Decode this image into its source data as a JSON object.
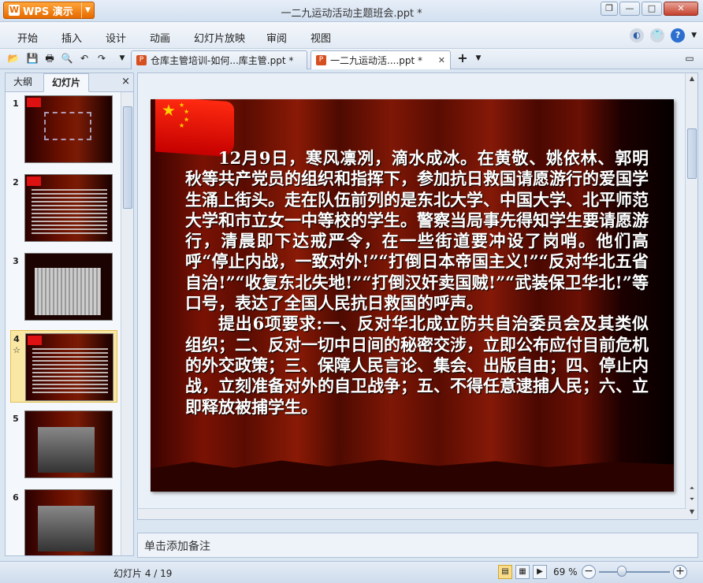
{
  "app": {
    "name": "WPS 演示",
    "doc_title": "一二九运动活动主题班会.ppt *"
  },
  "window_controls": {
    "restore": "❐",
    "minimize": "—",
    "maximize": "□",
    "close": "✕"
  },
  "menu": [
    "开始",
    "插入",
    "设计",
    "动画",
    "幻灯片放映",
    "审阅",
    "视图"
  ],
  "tabs": [
    {
      "label": "仓库主管培训-如何...库主管.ppt *"
    },
    {
      "label": "一二九运动活....ppt *"
    }
  ],
  "side_tabs": [
    "大纲",
    "幻灯片"
  ],
  "side_close": "×",
  "thumbnails": [
    {
      "num": "1"
    },
    {
      "num": "2"
    },
    {
      "num": "3"
    },
    {
      "num": "4",
      "star": "☆"
    },
    {
      "num": "5"
    },
    {
      "num": "6"
    }
  ],
  "slide": {
    "paragraphs": [
      "12月9日，寒风凛冽，滴水成冰。在黄敬、姚依林、郭明秋等共产党员的组织和指挥下，参加抗日救国请愿游行的爱国学生涌上街头。走在队伍前列的是东北大学、中国大学、北平师范大学和市立女一中等校的学生。警察当局事先得知学生要请愿游行，清晨即下达戒严令，在一些街道要冲设了岗哨。他们高呼“停止内战，一致对外!”“打倒日本帝国主义!”“反对华北五省自治!”“收复东北失地!”“打倒汉奸卖国贼!”“武装保卫华北!”等口号，表达了全国人民抗日救国的呼声。",
      "提出6项要求:一、反对华北成立防共自治委员会及其类似组织；二、反对一切中日间的秘密交涉，立即公布应付目前危机的外交政策；三、保障人民言论、集会、出版自由；四、停止内战，立刻准备对外的自卫战争；五、不得任意逮捕人民；六、立即释放被捕学生。"
    ]
  },
  "notes_placeholder": "单击添加备注",
  "status": {
    "slide_count": "幻灯片 4 / 19",
    "zoom": "69 %"
  }
}
